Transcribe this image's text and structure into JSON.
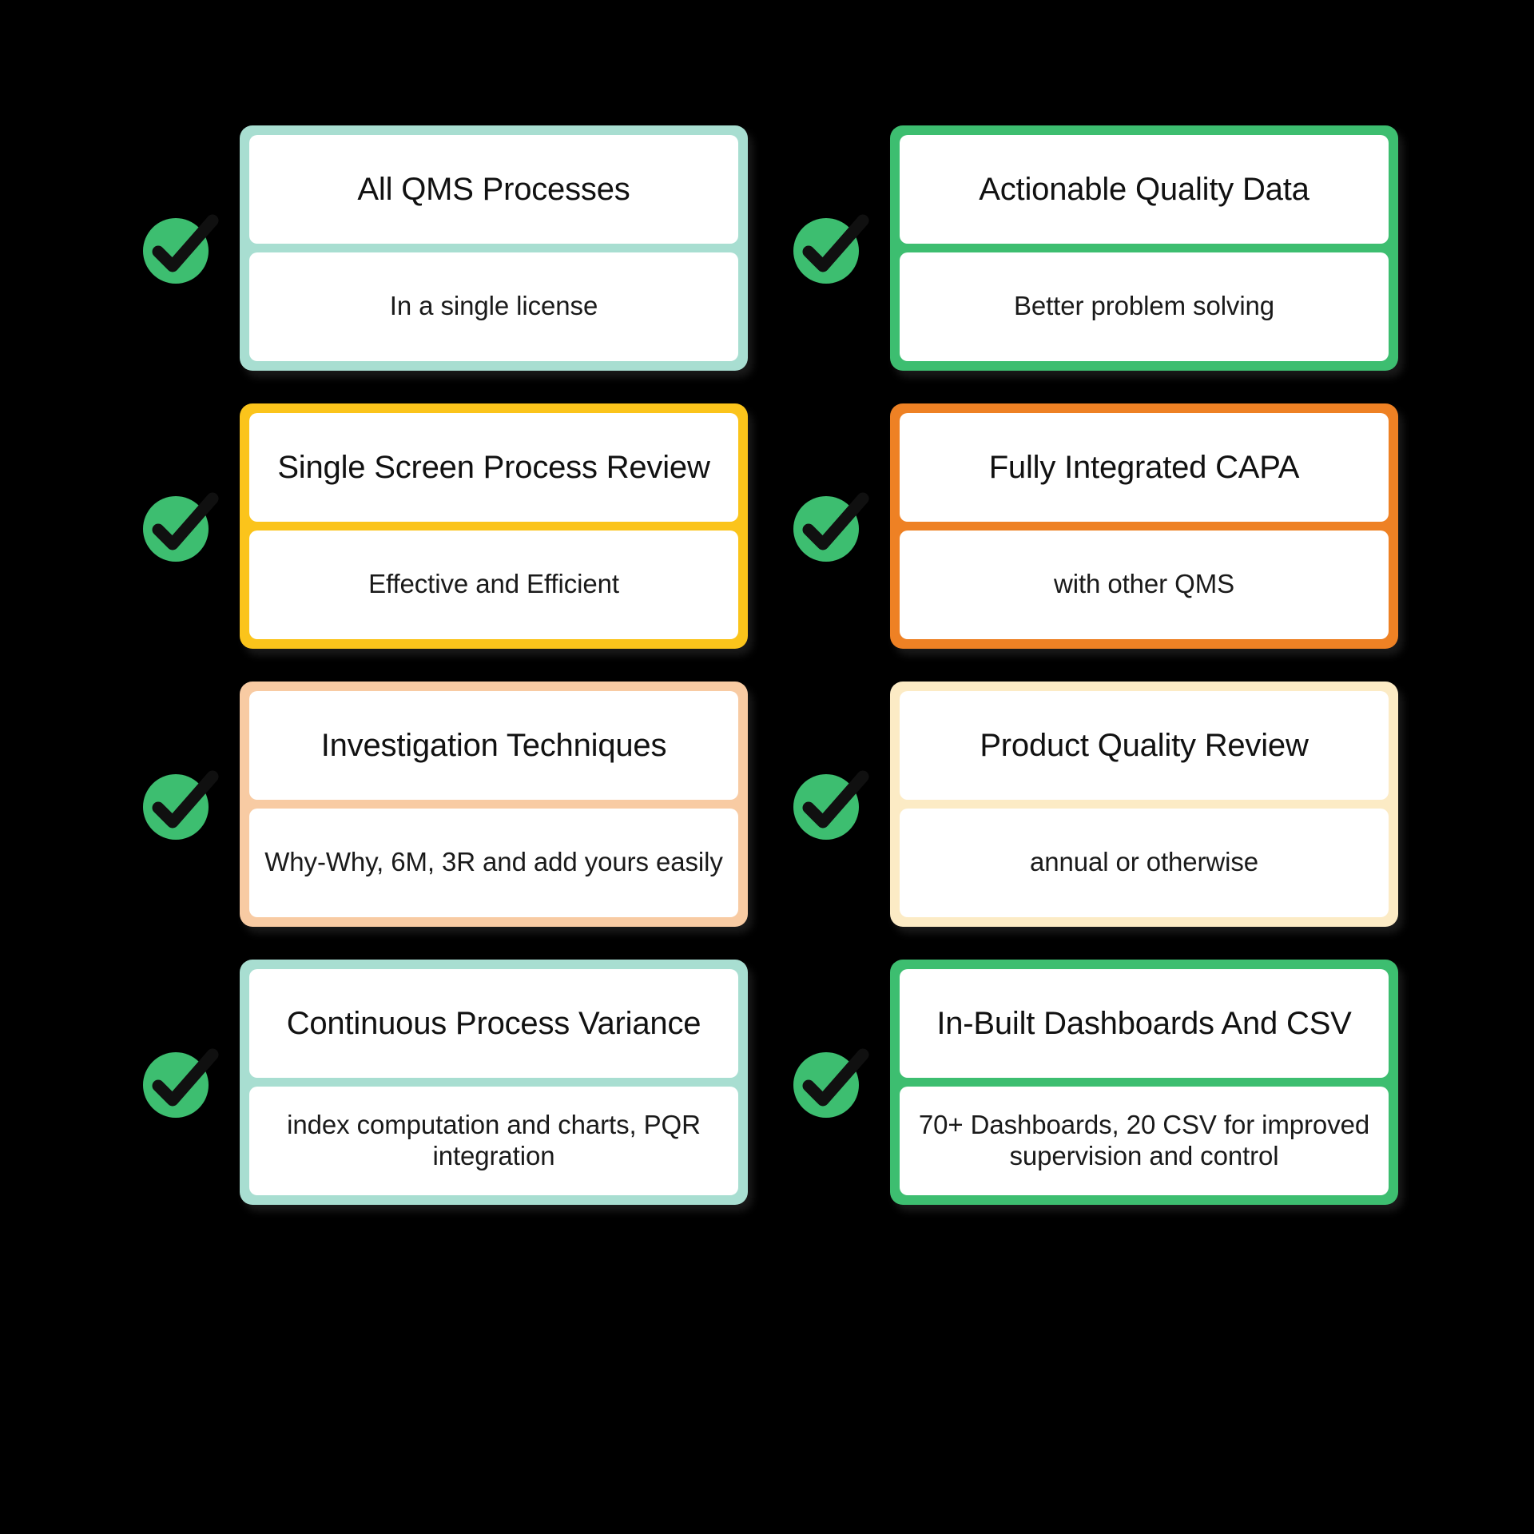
{
  "page": {
    "background_color": "#000000",
    "layout": "two-column-feature-grid",
    "columns": 2,
    "rows": 4
  },
  "icon": {
    "name": "green-check-circle",
    "circle_color": "#3DBE70",
    "check_color": "#101010"
  },
  "palette": {
    "mint": "#A8DED1",
    "green": "#3DBE70",
    "yellow": "#FBC41B",
    "orange": "#EE8124",
    "peach": "#F8CBA3",
    "cream": "#FCEBC5"
  },
  "features": [
    {
      "title": "All QMS Processes",
      "subtitle": "In a single license",
      "accent": "#A8DED1",
      "column": "left",
      "row": 1
    },
    {
      "title": "Actionable Quality Data",
      "subtitle": "Better problem solving",
      "accent": "#3DBE70",
      "column": "right",
      "row": 1
    },
    {
      "title": "Single Screen Process Review",
      "subtitle": "Effective and Efficient",
      "accent": "#FBC41B",
      "column": "left",
      "row": 2
    },
    {
      "title": "Fully Integrated CAPA",
      "subtitle": "with other QMS",
      "accent": "#EE8124",
      "column": "right",
      "row": 2
    },
    {
      "title": "Investigation Techniques",
      "subtitle": "Why-Why, 6M, 3R and add yours easily",
      "accent": "#F8CBA3",
      "column": "left",
      "row": 3
    },
    {
      "title": "Product Quality Review",
      "subtitle": "annual or otherwise",
      "accent": "#FCEBC5",
      "column": "right",
      "row": 3
    },
    {
      "title": "Continuous Process Variance",
      "subtitle": "index computation and charts, PQR integration",
      "accent": "#A8DED1",
      "column": "left",
      "row": 4
    },
    {
      "title": "In-Built Dashboards And CSV",
      "subtitle": "70+ Dashboards, 20 CSV for improved supervision and control",
      "accent": "#3DBE70",
      "column": "right",
      "row": 4
    }
  ]
}
